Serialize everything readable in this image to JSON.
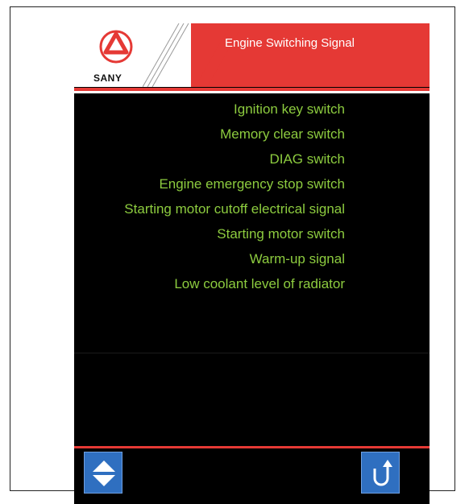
{
  "header": {
    "brand": "SANY",
    "title": "Engine Switching Signal"
  },
  "signals": [
    "Ignition key switch",
    "Memory clear switch",
    "DIAG switch",
    "Engine emergency stop switch",
    "Starting motor cutoff electrical signal",
    "Starting motor switch",
    "Warm-up signal",
    "Low coolant level of radiator"
  ],
  "colors": {
    "accent_red": "#e53935",
    "text_green": "#8dcc3f",
    "button_blue": "#2f6fc0",
    "background": "#000000"
  },
  "icons": {
    "scroll": "up-down-arrows-icon",
    "back": "return-arrow-icon"
  }
}
